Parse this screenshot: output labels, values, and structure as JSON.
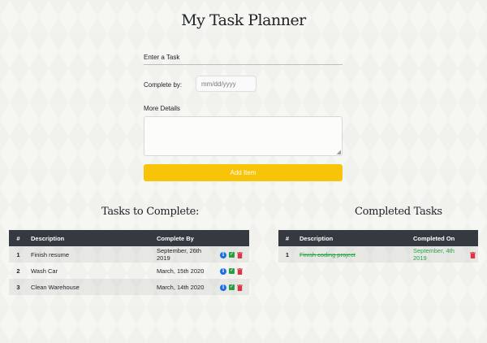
{
  "app": {
    "title": "My Task Planner"
  },
  "form": {
    "task_placeholder": "Enter a Task",
    "complete_by_label": "Complete by:",
    "date_placeholder": "mm/dd/yyyy",
    "details_label": "More Details",
    "add_button": "Add Item"
  },
  "todo": {
    "title": "Tasks to Complete:",
    "columns": {
      "num": "#",
      "desc": "Description",
      "date": "Complete By"
    },
    "rows": [
      {
        "num": "1",
        "desc": "Finish resume",
        "date": "September, 26th 2019"
      },
      {
        "num": "2",
        "desc": "Wash Car",
        "date": "March, 15th 2020"
      },
      {
        "num": "3",
        "desc": "Clean Warehouse",
        "date": "March, 14th 2020"
      }
    ]
  },
  "completed": {
    "title": "Completed Tasks",
    "columns": {
      "num": "#",
      "desc": "Description",
      "date": "Completed On"
    },
    "rows": [
      {
        "num": "1",
        "desc": "Finish coding project",
        "date": "September, 4th 2019"
      }
    ]
  },
  "icons": {
    "info": "info-icon",
    "complete": "checkbox-icon",
    "delete": "trash-icon"
  },
  "colors": {
    "accent": "#f7c408",
    "header_bg": "#343a40",
    "success": "#28a745",
    "danger": "#dc3545",
    "info": "#1c6fe3"
  }
}
